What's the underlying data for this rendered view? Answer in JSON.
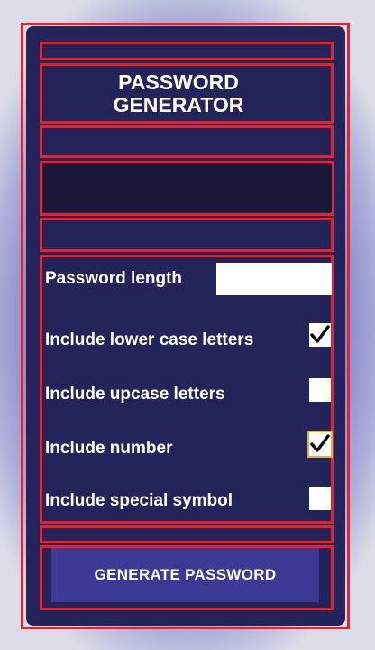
{
  "title": "PASSWORD\nGENERATOR",
  "password_output": "",
  "options": {
    "length_label": "Password length",
    "length_value": "",
    "lowercase": {
      "label": "Include lower case letters",
      "checked": true
    },
    "uppercase": {
      "label": "Include upcase letters",
      "checked": false
    },
    "numbers": {
      "label": "Include number",
      "checked": true
    },
    "symbols": {
      "label": "Include special symbol",
      "checked": false
    }
  },
  "generate_label": "GENERATE PASSWORD",
  "colors": {
    "card": "#24235a",
    "highlight": "#e8212b",
    "button": "#3d3a96",
    "output_bg": "#1a1838"
  }
}
